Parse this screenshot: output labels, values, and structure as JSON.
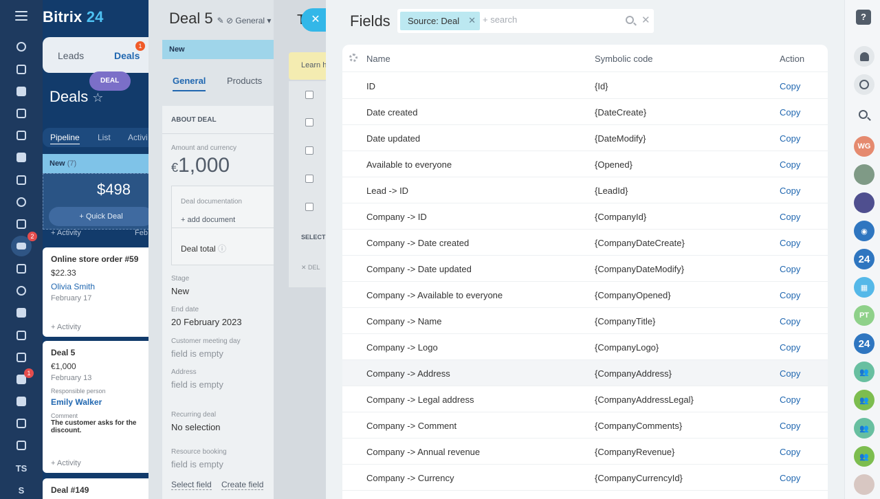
{
  "app": {
    "brand_name": "Bitrix",
    "brand_num": "24"
  },
  "left_sidebar": {
    "badges": {
      "crm": "2",
      "bot": "1"
    },
    "text_items": [
      "TS",
      "S"
    ]
  },
  "crm": {
    "tabs": {
      "leads": "Leads",
      "deals": "Deals",
      "deals_badge": "1"
    },
    "deal_pill": "DEAL",
    "board_title": "Deals",
    "views": {
      "pipeline": "Pipeline",
      "list": "List",
      "activities": "Activi"
    },
    "column": {
      "name": "New",
      "count": "(7)",
      "sum": "$498",
      "quick_deal": "+ Quick Deal"
    },
    "activity_label": "+ Activity",
    "activity_date_fragment": "Feb",
    "cards": [
      {
        "title": "Online store order #59",
        "price": "$22.33",
        "person": "Olivia Smith",
        "date": "February 17",
        "activity": "+ Activity"
      },
      {
        "title": "Deal 5",
        "price": "€1,000",
        "date": "February 13",
        "resp_label": "Responsible person",
        "resp_name": "Emily Walker",
        "comment_label": "Comment",
        "comment": "The customer asks for the discount.",
        "activity": "+ Activity"
      },
      {
        "title": "Deal #149"
      }
    ]
  },
  "deal": {
    "title": "Deal 5",
    "pipeline": "General",
    "stage_bar": "New",
    "tabs": {
      "general": "General",
      "products": "Products"
    },
    "section": "ABOUT DEAL",
    "amount_label": "Amount and currency",
    "amount_currency": "€",
    "amount_value": "1,000",
    "doc_label": "Deal documentation",
    "add_doc": "+ add document",
    "deal_total": "Deal total",
    "stage_label": "Stage",
    "stage_value": "New",
    "end_date_label": "End date",
    "end_date_value": "20 February 2023",
    "meeting_label": "Customer meeting day",
    "empty": "field is empty",
    "address_label": "Address",
    "recurring_label": "Recurring deal",
    "recurring_value": "No selection",
    "resource_label": "Resource booking",
    "select_field": "Select field",
    "create_field": "Create field"
  },
  "list_panel": {
    "title_letter": "T",
    "learn": "Learn h",
    "select": "SELECT",
    "delete": "✕ DEL"
  },
  "fields": {
    "title": "Fields",
    "filter_chip": "Source: Deal",
    "search_placeholder": "+ search",
    "columns": {
      "name": "Name",
      "code": "Symbolic code",
      "action": "Action"
    },
    "rows": [
      {
        "name": "ID",
        "code": "{Id}",
        "action": "Copy"
      },
      {
        "name": "Date created",
        "code": "{DateCreate}",
        "action": "Copy"
      },
      {
        "name": "Date updated",
        "code": "{DateModify}",
        "action": "Copy"
      },
      {
        "name": "Available to everyone",
        "code": "{Opened}",
        "action": "Copy"
      },
      {
        "name": "Lead -> ID",
        "code": "{LeadId}",
        "action": "Copy"
      },
      {
        "name": "Company -> ID",
        "code": "{CompanyId}",
        "action": "Copy"
      },
      {
        "name": "Company -> Date created",
        "code": "{CompanyDateCreate}",
        "action": "Copy"
      },
      {
        "name": "Company -> Date updated",
        "code": "{CompanyDateModify}",
        "action": "Copy"
      },
      {
        "name": "Company -> Available to everyone",
        "code": "{CompanyOpened}",
        "action": "Copy"
      },
      {
        "name": "Company -> Name",
        "code": "{CompanyTitle}",
        "action": "Copy"
      },
      {
        "name": "Company -> Logo",
        "code": "{CompanyLogo}",
        "action": "Copy"
      },
      {
        "name": "Company -> Address",
        "code": "{CompanyAddress}",
        "action": "Copy"
      },
      {
        "name": "Company -> Legal address",
        "code": "{CompanyAddressLegal}",
        "action": "Copy"
      },
      {
        "name": "Company -> Comment",
        "code": "{CompanyComments}",
        "action": "Copy"
      },
      {
        "name": "Company -> Annual revenue",
        "code": "{CompanyRevenue}",
        "action": "Copy"
      },
      {
        "name": "Company -> Currency",
        "code": "{CompanyCurrencyId}",
        "action": "Copy"
      }
    ]
  },
  "right_bar": {
    "help": "?",
    "avatars": {
      "wg": "WG",
      "pt": "PT",
      "b24": "24"
    }
  },
  "colors": {
    "accent": "#2067b0",
    "close_button": "#33b7e8",
    "filter_chip": "#bce8f1",
    "sidebar": "#1e3a5f"
  }
}
